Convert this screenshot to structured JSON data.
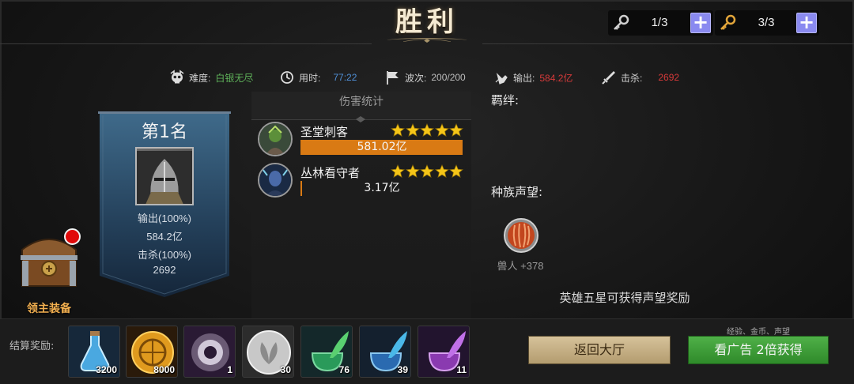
{
  "header": {
    "title": "胜利",
    "keys": [
      {
        "icon": "silver-key-icon",
        "count": "1/3"
      },
      {
        "icon": "gold-key-icon",
        "count": "3/3"
      }
    ],
    "plus_glyph": "+"
  },
  "stats": {
    "difficulty": {
      "icon": "skull-icon",
      "label": "难度:",
      "value": "白银无尽",
      "color": "#5fb25a"
    },
    "time": {
      "icon": "clock-icon",
      "label": "用时:",
      "value": "77:22",
      "color": "#4f8fd6"
    },
    "wave": {
      "icon": "flag-icon",
      "label": "波次:",
      "value": "200/200",
      "color": "#bdbdbd"
    },
    "output": {
      "icon": "fist-icon",
      "label": "输出:",
      "value": "584.2亿",
      "color": "#d63a3a"
    },
    "kills": {
      "icon": "sword-icon",
      "label": "击杀:",
      "value": "2692",
      "color": "#d63a3a"
    }
  },
  "rank_banner": {
    "rank": "第1名",
    "output_pct": "输出(100%)",
    "output_value": "584.2亿",
    "kill_pct": "击杀(100%)",
    "kill_value": "2692"
  },
  "chest": {
    "label": "领主装备",
    "icon": "treasure-chest-icon"
  },
  "damage_stats": {
    "title": "伤害统计",
    "heroes": [
      {
        "name": "圣堂刺客",
        "stars": 5,
        "damage": "581.02亿",
        "damage_fraction": 0.9946
      },
      {
        "name": "丛林看守者",
        "stars": 5,
        "damage": "3.17亿",
        "damage_fraction": 0.0054
      }
    ]
  },
  "bonds": {
    "label": "羁绊:"
  },
  "race": {
    "label": "种族声望:",
    "items": [
      {
        "icon": "orc-shield-icon",
        "text": "兽人 +378"
      }
    ]
  },
  "hint": "英雄五星可获得声望奖励",
  "rewards": {
    "label": "结算奖励:",
    "items": [
      {
        "icon": "blue-potion-icon",
        "count": "3200"
      },
      {
        "icon": "gold-coin-icon",
        "count": "8000"
      },
      {
        "icon": "dark-orb-icon",
        "count": "1"
      },
      {
        "icon": "silver-leaf-coin-icon",
        "count": "30"
      },
      {
        "icon": "green-quill-ink-icon",
        "count": "76"
      },
      {
        "icon": "blue-quill-ink-icon",
        "count": "39"
      },
      {
        "icon": "purple-quill-ink-icon",
        "count": "11"
      }
    ]
  },
  "buttons": {
    "back": "返回大厅",
    "ad": "看广告 2倍获得",
    "ad_sub": "经验、金币、声望"
  }
}
